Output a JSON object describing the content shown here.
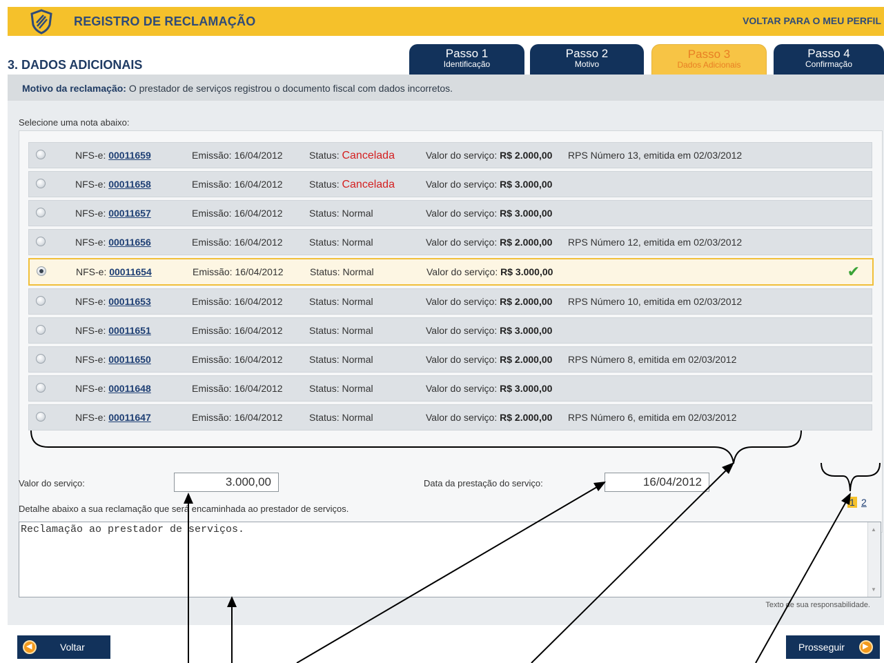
{
  "header": {
    "title": "REGISTRO DE RECLAMAÇÃO",
    "back_profile": "VOLTAR PARA O MEU PERFIL",
    "brand_color": "#f5c12b"
  },
  "section_title": "3. DADOS ADICIONAIS",
  "steps": [
    {
      "label": "Passo 1",
      "sub": "Identificação",
      "active": false
    },
    {
      "label": "Passo 2",
      "sub": "Motivo",
      "active": false
    },
    {
      "label": "Passo 3",
      "sub": "Dados Adicionais",
      "active": true
    },
    {
      "label": "Passo 4",
      "sub": "Confirmação",
      "active": false
    }
  ],
  "reason": {
    "label": "Motivo da reclamação:",
    "text": " O prestador de serviços registrou o documento fiscal com dados incorretos."
  },
  "select_label": "Selecione uma nota abaixo:",
  "field_labels": {
    "nfse": "NFS-e: ",
    "emissao": "Emissão: ",
    "status": "Status: ",
    "valor": "Valor do serviço: "
  },
  "notes": [
    {
      "number": "00011659",
      "emission": "16/04/2012",
      "status": "Cancelada",
      "value": "R$ 2.000,00",
      "rps": "RPS Número 13, emitida em 02/03/2012",
      "selected": false
    },
    {
      "number": "00011658",
      "emission": "16/04/2012",
      "status": "Cancelada",
      "value": "R$ 3.000,00",
      "rps": "",
      "selected": false
    },
    {
      "number": "00011657",
      "emission": "16/04/2012",
      "status": "Normal",
      "value": "R$ 3.000,00",
      "rps": "",
      "selected": false
    },
    {
      "number": "00011656",
      "emission": "16/04/2012",
      "status": "Normal",
      "value": "R$ 2.000,00",
      "rps": "RPS Número 12, emitida em 02/03/2012",
      "selected": false
    },
    {
      "number": "00011654",
      "emission": "16/04/2012",
      "status": "Normal",
      "value": "R$ 3.000,00",
      "rps": "",
      "selected": true
    },
    {
      "number": "00011653",
      "emission": "16/04/2012",
      "status": "Normal",
      "value": "R$ 2.000,00",
      "rps": "RPS Número 10, emitida em 02/03/2012",
      "selected": false
    },
    {
      "number": "00011651",
      "emission": "16/04/2012",
      "status": "Normal",
      "value": "R$ 3.000,00",
      "rps": "",
      "selected": false
    },
    {
      "number": "00011650",
      "emission": "16/04/2012",
      "status": "Normal",
      "value": "R$ 2.000,00",
      "rps": "RPS Número 8, emitida em 02/03/2012",
      "selected": false
    },
    {
      "number": "00011648",
      "emission": "16/04/2012",
      "status": "Normal",
      "value": "R$ 3.000,00",
      "rps": "",
      "selected": false
    },
    {
      "number": "00011647",
      "emission": "16/04/2012",
      "status": "Normal",
      "value": "R$ 2.000,00",
      "rps": "RPS Número 6, emitida em 02/03/2012",
      "selected": false
    }
  ],
  "pagination": {
    "current": "1",
    "next": "2"
  },
  "form": {
    "valor_label": "Valor do serviço:",
    "valor_value": "3.000,00",
    "data_label": "Data da prestação do serviço:",
    "data_value": "16/04/2012",
    "detail_label": "Detalhe abaixo a sua reclamação que será encaminhada ao prestador de serviços.",
    "textarea_value": "Reclamação ao prestador de serviços.",
    "hint": "Texto de sua responsabilidade."
  },
  "buttons": {
    "back": "Voltar",
    "next": "Prosseguir"
  },
  "icons": {
    "shield": "shield-icon",
    "check": "check-icon",
    "prev": "arrow-left-icon",
    "next": "arrow-right-icon"
  }
}
